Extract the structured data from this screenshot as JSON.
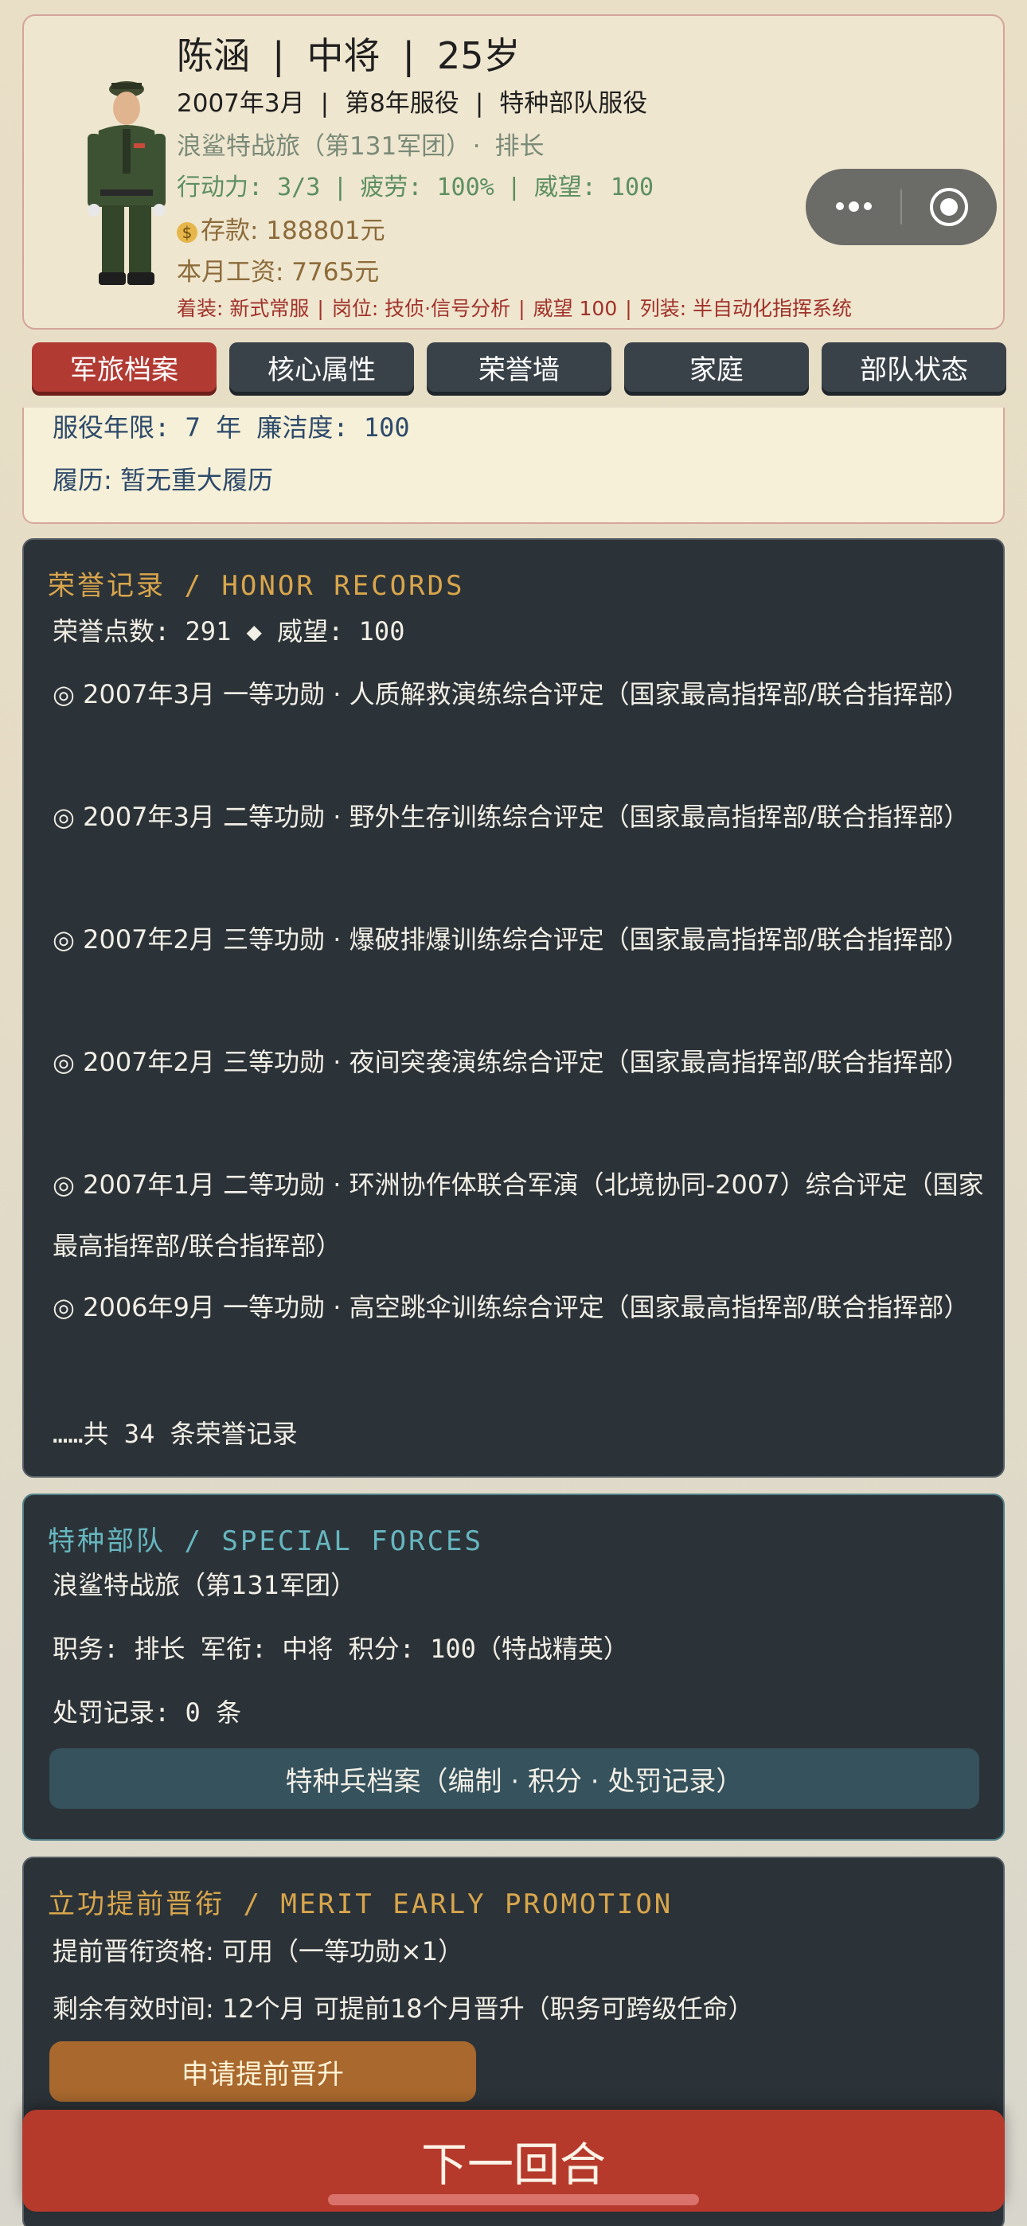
{
  "header": {
    "name": "陈涵",
    "rank": "中将",
    "age": "25岁",
    "date": "2007年3月",
    "service_year": "第8年服役",
    "service_type": "特种部队服役",
    "unit": "浪鲨特战旅（第131军团）",
    "unit_sep": "·",
    "position": "排长",
    "stats_text": "行动力: 3/3",
    "fatigue_text": "疲劳: 100%",
    "prestige_text": "威望: 100",
    "money_icon": "money-bag-icon",
    "money_text": "存款: 188801元",
    "salary_text": "本月工资: 7765元",
    "equip_uniform": "着装: 新式常服",
    "equip_post": "岗位: 技侦·信号分析",
    "equip_prestige": "威望 100",
    "equip_list": "列装: 半自动化指挥系统",
    "separator": "|"
  },
  "tabs": [
    {
      "label": "军旅档案",
      "active": true
    },
    {
      "label": "核心属性",
      "active": false
    },
    {
      "label": "荣誉墙",
      "active": false
    },
    {
      "label": "家庭",
      "active": false
    },
    {
      "label": "部队状态",
      "active": false
    }
  ],
  "profile": {
    "line1": "服役年限: 7 年  廉洁度: 100",
    "line2": "履历: 暂无重大履历"
  },
  "honor": {
    "title": "荣誉记录 / HONOR RECORDS",
    "summary": "荣誉点数: 291 ◆  威望: 100",
    "items": [
      "◎ 2007年3月 一等功勋 · 人质解救演练综合评定（国家最高指挥部/联合指挥部）",
      "◎ 2007年3月 二等功勋 · 野外生存训练综合评定（国家最高指挥部/联合指挥部）",
      "◎ 2007年2月 三等功勋 · 爆破排爆训练综合评定（国家最高指挥部/联合指挥部）",
      "◎ 2007年2月 三等功勋 · 夜间突袭演练综合评定（国家最高指挥部/联合指挥部）",
      "◎ 2007年1月 二等功勋 · 环洲协作体联合军演（北境协同-2007）综合评定（国家最高指挥部/联合指挥部）",
      "◎ 2006年9月 一等功勋 · 高空跳伞训练综合评定（国家最高指挥部/联合指挥部）"
    ],
    "more": "……共 34 条荣誉记录"
  },
  "forces": {
    "title": "特种部队 / SPECIAL FORCES",
    "unit": "浪鲨特战旅（第131军团）",
    "duty": "职务: 排长  军衔: 中将  积分: 100（特战精英）",
    "penalty": "处罚记录: 0 条",
    "button": "特种兵档案（编制 · 积分 · 处罚记录）"
  },
  "merit": {
    "title": "立功提前晋衔 / MERIT EARLY PROMOTION",
    "eligibility": "提前晋衔资格: 可用（一等功勋×1）",
    "remaining": "剩余有效时间: 12个月  可提前18个月晋升（职务可跨级任命）",
    "button": "申请提前晋升"
  },
  "next_turn": "下一回合",
  "colors": {
    "accent_red": "#b13a33",
    "gold": "#d9a64c",
    "teal": "#66b7c0",
    "card_dark": "#2c3338"
  }
}
